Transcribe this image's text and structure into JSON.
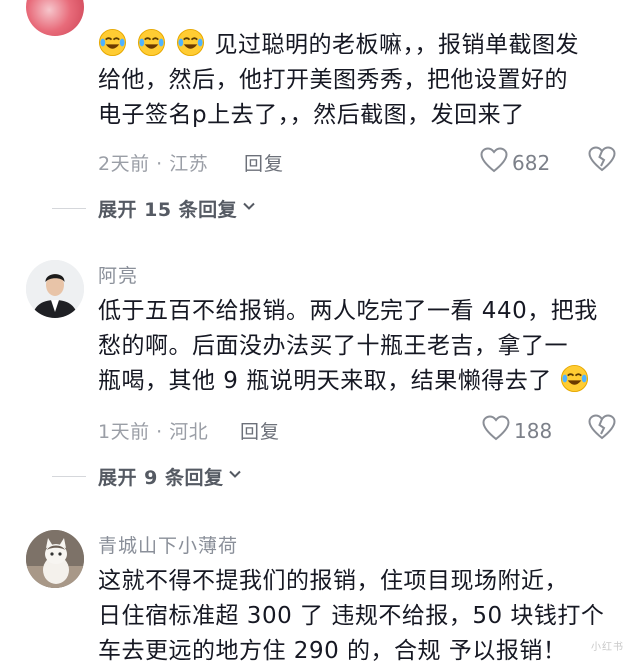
{
  "comments": [
    {
      "author": "",
      "lines": [
        "见过聪明的老板嘛，，报销单截图发",
        "给他，然后，他打开美图秀秀，把他设置好的",
        "电子签名p上去了，，然后截图，发回来了"
      ],
      "leading_emoji": [
        "crying-laughing-emoji",
        "crying-laughing-emoji",
        "crying-laughing-emoji"
      ],
      "time_location": "2天前 · 江苏",
      "reply_label": "回复",
      "likes": "682",
      "expand_label": "展开 15 条回复"
    },
    {
      "author": "阿亮",
      "lines": [
        "低于五百不给报销。两人吃完了一看 440，把我",
        "愁的啊。后面没办法买了十瓶王老吉，拿了一",
        "瓶喝，其他 9 瓶说明天来取，结果懒得去了"
      ],
      "trailing_emoji": "crying-laughing-emoji",
      "time_location": "1天前 · 河北",
      "reply_label": "回复",
      "likes": "188",
      "expand_label": "展开 9 条回复"
    },
    {
      "author": "青城山下小薄荷",
      "lines": [
        "这就不得不提我们的报销，住项目现场附近，",
        "日住宿标准超 300 了 违规不给报，50 块钱打个",
        "车去更远的地方住 290 的，合规 予以报销！"
      ]
    }
  ],
  "icons": {
    "like": "heart-outline-icon",
    "dislike": "broken-heart-icon",
    "expand": "chevron-down-icon"
  },
  "watermark": "小红书"
}
